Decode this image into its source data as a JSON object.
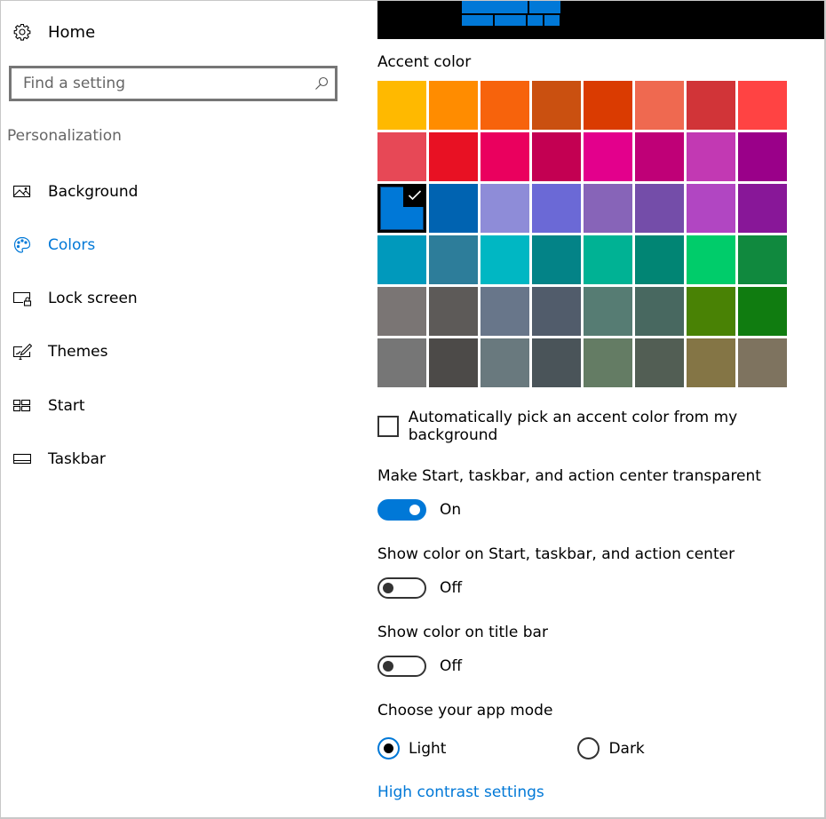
{
  "sidebar": {
    "home_label": "Home",
    "search": {
      "placeholder": "Find a setting",
      "value": ""
    },
    "section_label": "Personalization",
    "items": [
      {
        "label": "Background",
        "icon": "picture-icon",
        "active": false
      },
      {
        "label": "Colors",
        "icon": "palette-icon",
        "active": true
      },
      {
        "label": "Lock screen",
        "icon": "lock-screen-icon",
        "active": false
      },
      {
        "label": "Themes",
        "icon": "themes-icon",
        "active": false
      },
      {
        "label": "Start",
        "icon": "start-icon",
        "active": false
      },
      {
        "label": "Taskbar",
        "icon": "taskbar-icon",
        "active": false
      }
    ]
  },
  "main": {
    "accent_heading": "Accent color",
    "selected_accent": "#0078D7",
    "accent_colors": [
      [
        "#FFB900",
        "#FF8C00",
        "#F7630C",
        "#CA5010",
        "#DA3B01",
        "#EF6950",
        "#D13438",
        "#FF4343"
      ],
      [
        "#E74856",
        "#E81123",
        "#EA005E",
        "#C30052",
        "#E3008C",
        "#BF0077",
        "#C239B3",
        "#9A0089"
      ],
      [
        "#0078D7",
        "#0063B1",
        "#8E8CD8",
        "#6B69D6",
        "#8764B8",
        "#744DA9",
        "#B146C2",
        "#881798"
      ],
      [
        "#0099BC",
        "#2D7D9A",
        "#00B7C3",
        "#038387",
        "#00B294",
        "#018574",
        "#00CC6A",
        "#10893E"
      ],
      [
        "#7A7574",
        "#5D5A58",
        "#68768A",
        "#515C6B",
        "#567C73",
        "#486860",
        "#498205",
        "#107C10"
      ],
      [
        "#767676",
        "#4C4A48",
        "#69797E",
        "#4A5459",
        "#647C64",
        "#525E54",
        "#847545",
        "#7E735F"
      ]
    ],
    "auto_pick": {
      "label": "Automatically pick an accent color from my background",
      "checked": false
    },
    "transparency": {
      "label": "Make Start, taskbar, and action center transparent",
      "state": "On"
    },
    "color_start": {
      "label": "Show color on Start, taskbar, and action center",
      "state": "Off"
    },
    "color_titlebar": {
      "label": "Show color on title bar",
      "state": "Off"
    },
    "app_mode": {
      "label": "Choose your app mode",
      "options": [
        "Light",
        "Dark"
      ],
      "selected": "Light"
    },
    "high_contrast_link": "High contrast settings",
    "accent_blue": "#0078D7"
  }
}
